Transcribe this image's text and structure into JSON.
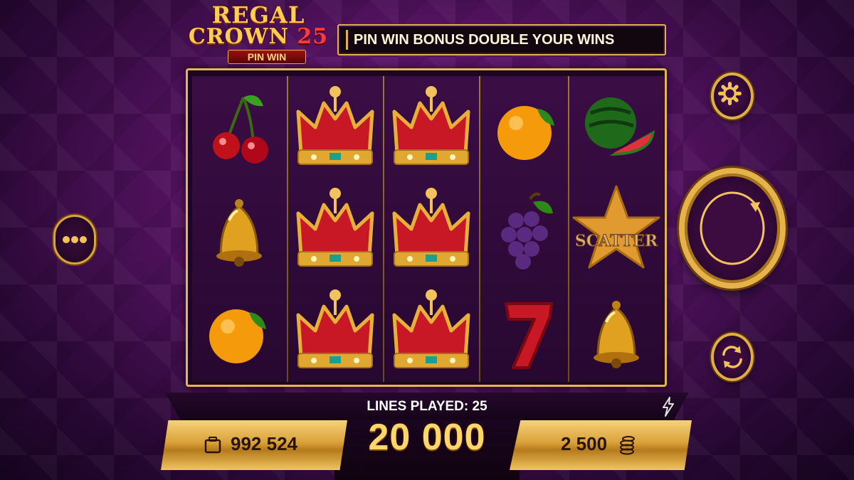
{
  "logo": {
    "line1": "REGAL",
    "line2_word": "CROWN",
    "line2_num": "25",
    "sub": "PIN WIN"
  },
  "ticker": {
    "text": "PIN WIN BONUS DOUBLE YOUR WINS"
  },
  "reels": [
    [
      "cherry",
      "bell",
      "orange"
    ],
    [
      "crown",
      "crown",
      "crown"
    ],
    [
      "crown",
      "crown",
      "crown"
    ],
    [
      "orange",
      "grapes",
      "seven"
    ],
    [
      "watermelon",
      "scatter-star",
      "bell"
    ]
  ],
  "scatter_label": "SCATTER",
  "buttons": {
    "menu": "menu-icon",
    "settings": "gear-icon",
    "spin": "spin-icon",
    "autoplay": "autoplay-icon"
  },
  "bottom": {
    "lines_played": "LINES PLAYED: 25",
    "bet": "20 000",
    "balance": "992 524",
    "stake": "2 500"
  },
  "colors": {
    "gold": "#e5b54e",
    "purple": "#5a1467",
    "amount": "#ffd66a"
  }
}
